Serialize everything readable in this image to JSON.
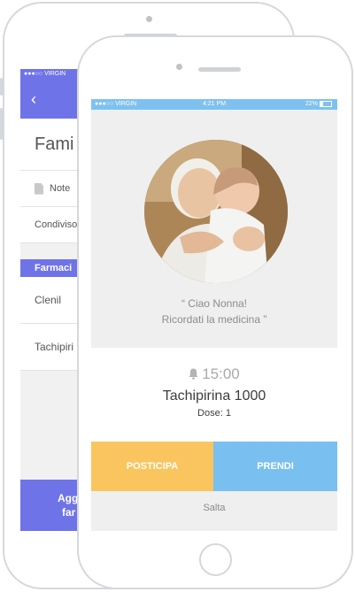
{
  "back_app": {
    "status": {
      "carrier": "●●●○○ VIRGIN"
    },
    "nav": {
      "back_icon": "chevron-left-icon",
      "back_glyph": "‹"
    },
    "title": "Fami",
    "note_label": "Note",
    "shared_label": "Condiviso",
    "section_label": "Farmaci",
    "items": [
      "Clenil",
      "Tachipiri"
    ],
    "add_button": {
      "line1": "Agg",
      "line2": "far"
    },
    "colors": {
      "accent": "#6f73e8"
    }
  },
  "front_app": {
    "status": {
      "carrier": "●●●○○ VIRGIN",
      "time": "4:21 PM",
      "battery": "22%"
    },
    "photo": {
      "subject": "grandmother holding baby",
      "shape": "circle"
    },
    "message": {
      "line1": "“ Ciao Nonna!",
      "line2": "Ricordati la medicina ”"
    },
    "reminder": {
      "time": "15:00",
      "icon": "bell-icon",
      "drug": "Tachipirina 1000",
      "dose": "Dose: 1"
    },
    "actions": {
      "postpone": "POSTICIPA",
      "take": "PRENDI",
      "skip": "Salta"
    },
    "colors": {
      "status_bar": "#7ec1f1",
      "postpone": "#fac55f",
      "take": "#79bff0"
    }
  }
}
